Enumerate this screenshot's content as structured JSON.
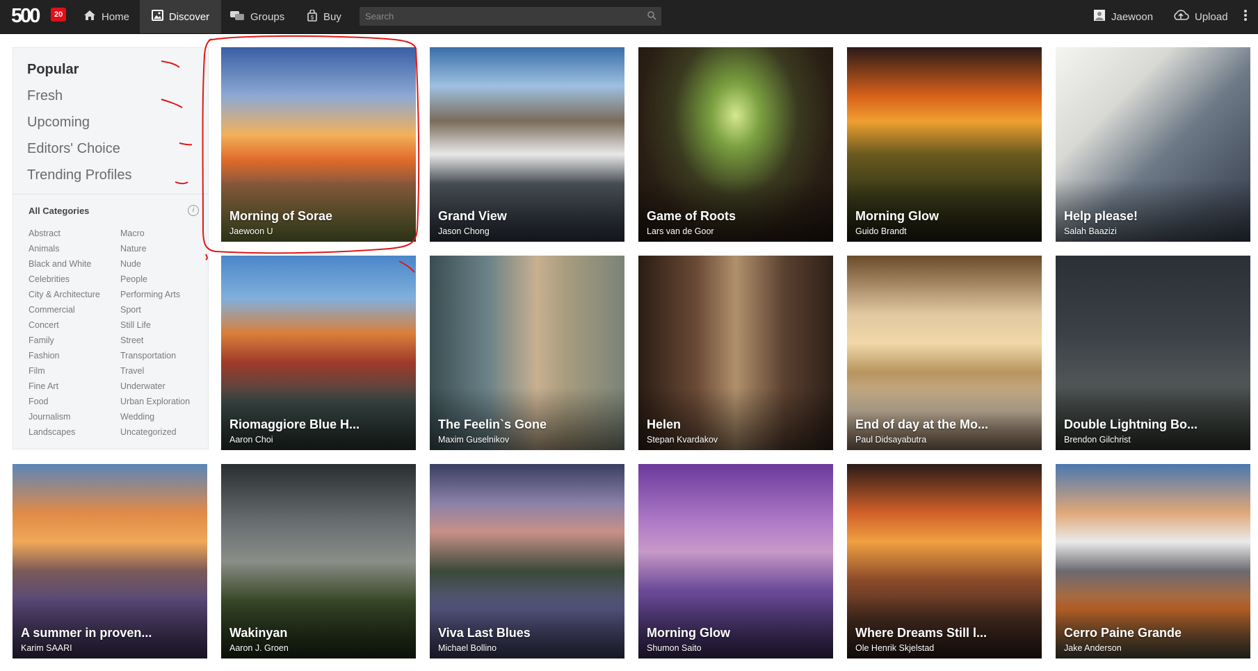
{
  "topbar": {
    "logo_text": "500",
    "notification_count": "20",
    "nav": {
      "home": "Home",
      "discover": "Discover",
      "groups": "Groups",
      "buy": "Buy"
    },
    "search_placeholder": "Search",
    "user_name": "Jaewoon",
    "upload": "Upload",
    "icons": [
      "home-icon",
      "discover-icon",
      "groups-icon",
      "buy-icon",
      "search-icon",
      "user-avatar-icon",
      "upload-cloud-icon",
      "more-vertical-icon"
    ]
  },
  "sidebar": {
    "sorts": [
      "Popular",
      "Fresh",
      "Upcoming",
      "Editors' Choice",
      "Trending Profiles"
    ],
    "active_sort": "Popular",
    "categories_title": "All Categories",
    "categories_col1": [
      "Abstract",
      "Animals",
      "Black and White",
      "Celebrities",
      "City & Architecture",
      "Commercial",
      "Concert",
      "Family",
      "Fashion",
      "Film",
      "Fine Art",
      "Food",
      "Journalism",
      "Landscapes"
    ],
    "categories_col2": [
      "Macro",
      "Nature",
      "Nude",
      "People",
      "Performing Arts",
      "Sport",
      "Still Life",
      "Street",
      "Transportation",
      "Travel",
      "Underwater",
      "Urban Exploration",
      "Wedding",
      "Uncategorized"
    ]
  },
  "photos": [
    {
      "title": "Morning of Sorae",
      "author": "Jaewoon U"
    },
    {
      "title": "Grand View",
      "author": "Jason Chong"
    },
    {
      "title": "Game of Roots",
      "author": "Lars van de Goor"
    },
    {
      "title": "Morning Glow",
      "author": "Guido Brandt"
    },
    {
      "title": "Help please!",
      "author": "Salah Baazizi"
    },
    {
      "title": "Riomaggiore Blue H...",
      "author": "Aaron Choi"
    },
    {
      "title": "The Feelin`s Gone",
      "author": "Maxim Guselnikov"
    },
    {
      "title": "Helen",
      "author": "Stepan Kvardakov"
    },
    {
      "title": "End of day at the Mo...",
      "author": "Paul Didsayabutra"
    },
    {
      "title": "Double Lightning Bo...",
      "author": "Brendon Gilchrist"
    },
    {
      "title": "A summer in proven...",
      "author": "Karim SAARI"
    },
    {
      "title": "Wakinyan",
      "author": "Aaron J. Groen"
    },
    {
      "title": "Viva Last Blues",
      "author": "Michael Bollino"
    },
    {
      "title": "Morning Glow",
      "author": "Shumon Saito"
    },
    {
      "title": "Where Dreams Still l...",
      "author": "Ole Henrik Skjelstad"
    },
    {
      "title": "Cerro Paine Grande",
      "author": "Jake Anderson"
    }
  ],
  "colors": {
    "topbar_bg": "#222222",
    "badge_red": "#e0101b",
    "annotation_red": "#e01818",
    "sidebar_bg": "#f4f5f6"
  }
}
